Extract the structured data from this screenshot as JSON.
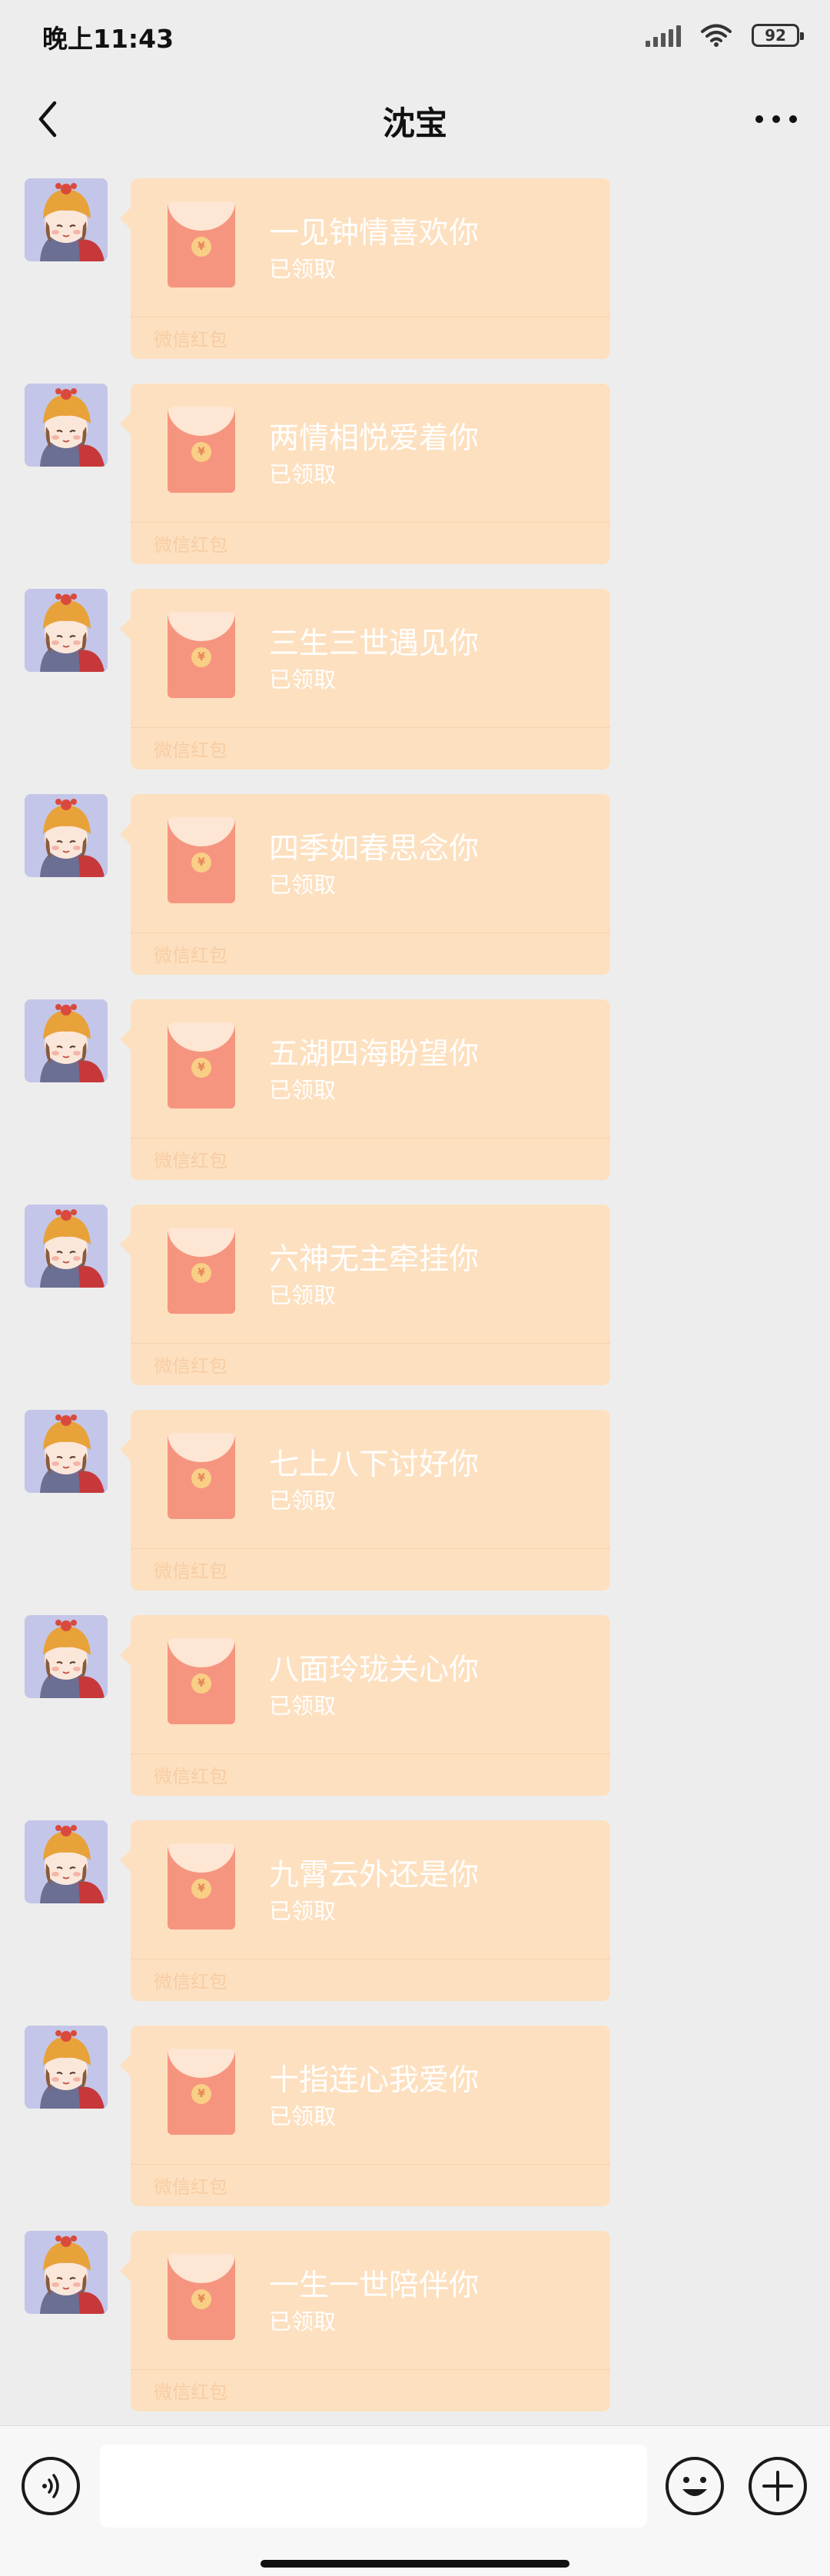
{
  "status_bar": {
    "time": "晚上11:43",
    "battery": "92"
  },
  "nav": {
    "title": "沈宝"
  },
  "red_packet": {
    "status": "已领取",
    "footer": "微信红包",
    "coin_symbol": "¥"
  },
  "messages": [
    {
      "title": "一见钟情喜欢你"
    },
    {
      "title": "两情相悦爱着你"
    },
    {
      "title": "三生三世遇见你"
    },
    {
      "title": "四季如春思念你"
    },
    {
      "title": "五湖四海盼望你"
    },
    {
      "title": "六神无主牵挂你"
    },
    {
      "title": "七上八下讨好你"
    },
    {
      "title": "八面玲珑关心你"
    },
    {
      "title": "九霄云外还是你"
    },
    {
      "title": "十指连心我爱你"
    },
    {
      "title": "一生一世陪伴你"
    }
  ],
  "input_bar": {
    "placeholder": ""
  },
  "colors": {
    "bubble": "#fde0bf",
    "envelope": "#f6957f",
    "background": "#ededed"
  }
}
